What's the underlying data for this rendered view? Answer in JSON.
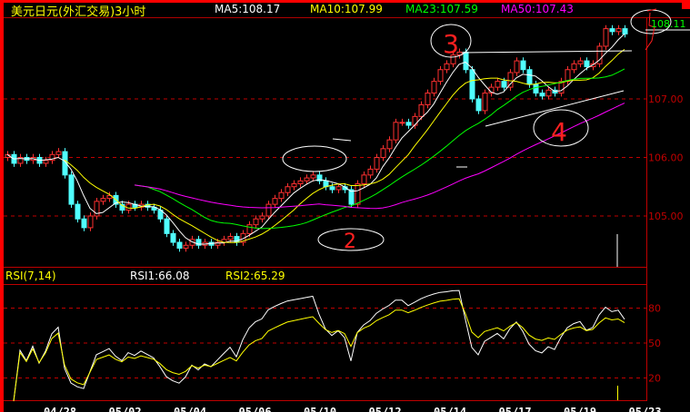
{
  "header": {
    "title": "美元日元(外汇交易)3小时",
    "ma5": "MA5:108.17",
    "ma10": "MA10:107.99",
    "ma23": "MA23:107.59",
    "ma50": "MA50:107.43"
  },
  "rsi_header": {
    "title": "RSI(7,14)",
    "rsi1": "RSI1:66.08",
    "rsi2": "RSI2:65.29"
  },
  "current_price_label": "108.11",
  "annotations": [
    "2",
    "3",
    "4"
  ],
  "colors": {
    "up": "#ff3030",
    "down": "#50ffff",
    "ma5": "#ffffff",
    "ma10": "#ffff00",
    "ma23": "#00ff00",
    "ma50": "#ff00ff",
    "axis": "#c00000",
    "rsi1": "#ffffff",
    "rsi2": "#ffff00"
  },
  "chart_data": [
    {
      "type": "candlestick",
      "title": "美元日元(外汇交易)3小时",
      "ylim": [
        104.2,
        108.3
      ],
      "yticks": [
        "105.00",
        "106.00",
        "107.00"
      ],
      "xticks": [
        "04/28",
        "05/02",
        "05/04",
        "05/06",
        "05/10",
        "05/12",
        "05/14",
        "05/17",
        "05/19",
        "05/23"
      ],
      "grid": true,
      "close": [
        106.05,
        105.9,
        106.0,
        105.95,
        106.0,
        105.9,
        105.95,
        106.05,
        106.1,
        105.7,
        105.2,
        104.95,
        104.8,
        105.0,
        105.25,
        105.3,
        105.35,
        105.2,
        105.1,
        105.2,
        105.15,
        105.2,
        105.15,
        105.1,
        104.95,
        104.7,
        104.55,
        104.45,
        104.5,
        104.6,
        104.5,
        104.55,
        104.5,
        104.55,
        104.6,
        104.65,
        104.55,
        104.7,
        104.85,
        104.95,
        105.0,
        105.2,
        105.3,
        105.4,
        105.5,
        105.55,
        105.6,
        105.65,
        105.7,
        105.6,
        105.5,
        105.45,
        105.5,
        105.45,
        105.2,
        105.55,
        105.7,
        105.8,
        106.0,
        106.15,
        106.3,
        106.6,
        106.6,
        106.55,
        106.7,
        106.9,
        107.1,
        107.3,
        107.5,
        107.6,
        107.75,
        107.8,
        107.5,
        107.0,
        106.8,
        107.1,
        107.2,
        107.3,
        107.2,
        107.45,
        107.65,
        107.5,
        107.25,
        107.1,
        107.05,
        107.15,
        107.1,
        107.3,
        107.5,
        107.6,
        107.65,
        107.55,
        107.6,
        107.9,
        108.2,
        108.15,
        108.2,
        108.11
      ],
      "series": [
        {
          "name": "MA5",
          "period": 5
        },
        {
          "name": "MA10",
          "period": 10
        },
        {
          "name": "MA23",
          "period": 23
        },
        {
          "name": "MA50",
          "period": 50
        }
      ]
    },
    {
      "type": "line",
      "title": "RSI(7,14)",
      "ylim": [
        0,
        100
      ],
      "yticks": [
        "20",
        "50",
        "80"
      ],
      "series": [
        {
          "name": "RSI1",
          "period": 7
        },
        {
          "name": "RSI2",
          "period": 14
        }
      ]
    }
  ]
}
